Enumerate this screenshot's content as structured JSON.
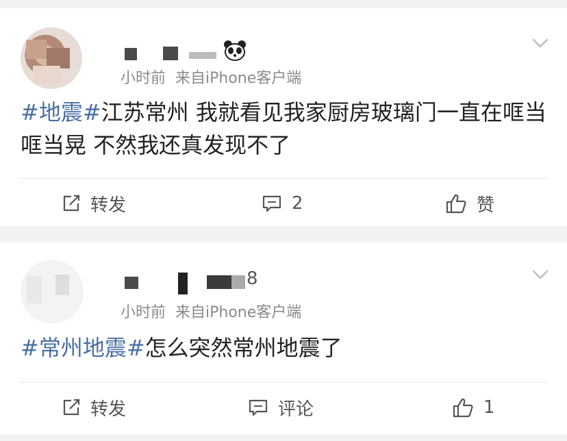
{
  "posts": [
    {
      "meta_time": "小时前",
      "meta_source": "来自iPhone客户端",
      "content_tag": "#地震#",
      "content_text": "江苏常州 我就看见我家厨房玻璃门一直在哐当哐当晃 不然我还真发现不了",
      "actions": {
        "repost_label": "转发",
        "comment_count": "2",
        "like_label": "赞"
      }
    },
    {
      "name_tail": "8",
      "meta_time": "小时前",
      "meta_source": "来自iPhone客户端",
      "content_tag": "#常州地震#",
      "content_text": "怎么突然常州地震了",
      "actions": {
        "repost_label": "转发",
        "comment_label": "评论",
        "like_count": "1"
      }
    }
  ],
  "colors": {
    "topic_link": "#4a6fa5",
    "meta_text": "#8a8a8a",
    "background": "#f2f2f2"
  },
  "icons": [
    "panda-emoji-icon",
    "chevron-down-icon",
    "repost-icon",
    "comment-icon",
    "like-thumb-icon"
  ]
}
